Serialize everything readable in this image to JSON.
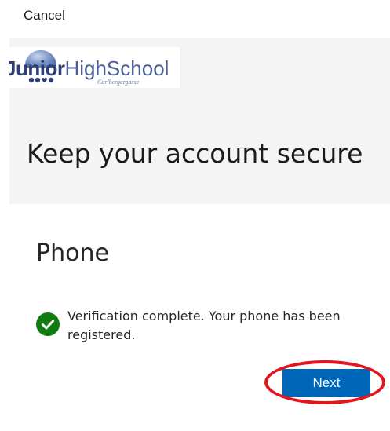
{
  "top_bar": {
    "cancel_label": "Cancel"
  },
  "logo": {
    "word_bold": "Junior",
    "word_light": "HighSchool",
    "subtitle": "Carlbergergasse",
    "colors": {
      "bold": "#2c3e73",
      "light": "#4a5f96"
    }
  },
  "header": {
    "title": "Keep your account secure"
  },
  "main": {
    "section_title": "Phone",
    "status_icon": "check-circle-icon",
    "status_color": "#107c10",
    "message": "Verification complete. Your phone has been registered.",
    "next_label": "Next",
    "accent": "#0067b8"
  },
  "annotation": {
    "ring_color": "#e3141b"
  }
}
